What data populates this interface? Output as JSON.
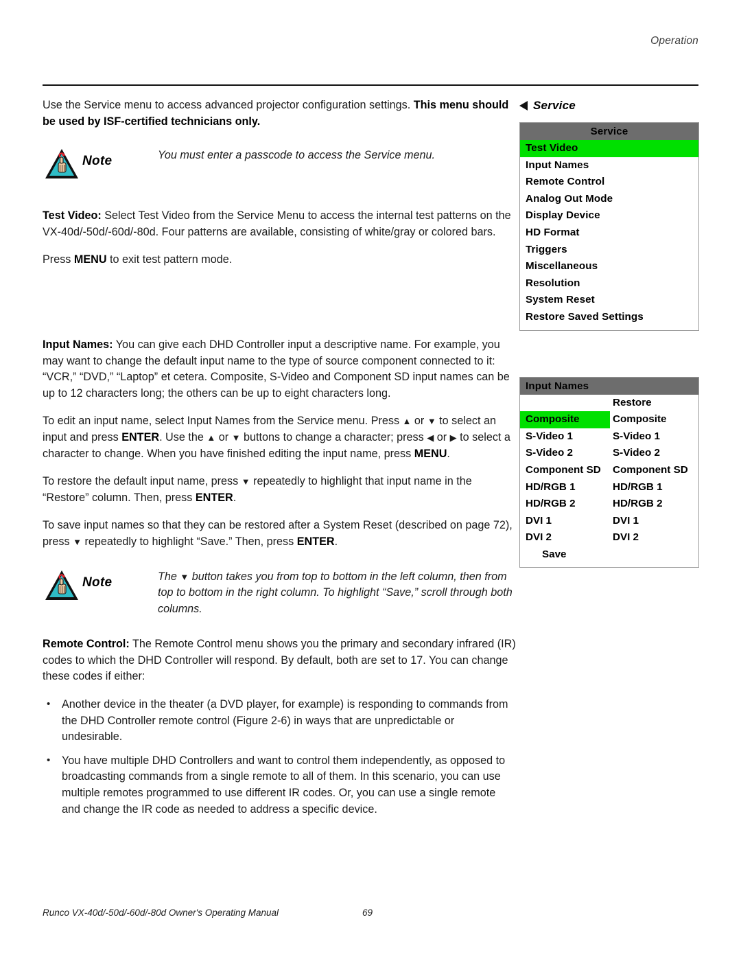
{
  "header": {
    "running_head": "Operation"
  },
  "body": {
    "intro_normal": "Use the Service menu to access advanced projector configuration settings. ",
    "intro_bold": "This menu should be used by ISF-certified technicians only.",
    "note1": "You must enter a passcode to access the Service menu.",
    "note_label": "Note",
    "testvideo_label": "Test Video:",
    "testvideo_text": " Select Test Video from the Service Menu to access the internal test patterns on the VX-40d/-50d/-60d/-80d. Four patterns are available, consisting of white/gray or colored bars.",
    "press_menu_pre": "Press ",
    "press_menu_bold": "MENU",
    "press_menu_post": " to exit test pattern mode.",
    "inputnames_label": "Input Names:",
    "inputnames_text": " You can give each DHD Controller input a descriptive name. For example, you may want to change the default input name to the type of source component connected to it: “VCR,” “DVD,” “Laptop” et cetera. Composite, S-Video and Component SD input names can be up to 12 characters long; the others can be up to eight characters long.",
    "edit_p1": "To edit an input name, select Input Names from the Service menu. Press ",
    "edit_p2": " or ",
    "edit_p3": " to select an input and press ",
    "edit_enter": "ENTER",
    "edit_p4": ". Use the ",
    "edit_p5": " or ",
    "edit_p6": " buttons to change a character; press ",
    "edit_p7": " or ",
    "edit_p8": " to select a character to change. When you have finished editing the input name, press ",
    "edit_menu": "MENU",
    "edit_p9": ".",
    "restore_p1": "To restore the default input name, press ",
    "restore_p2": " repeatedly to highlight that input name in the “Restore” column. Then, press ",
    "restore_enter": "ENTER",
    "restore_p3": ".",
    "save_p1": "To save input names so that they can be restored after a System Reset (described on page 72), press ",
    "save_p2": " repeatedly to highlight “Save.” Then, press ",
    "save_enter": "ENTER",
    "save_p3": ".",
    "note2_p1": "The ",
    "note2_p2": " button takes you from top to bottom in the left column, then from top to bottom in the right column. To highlight “Save,” scroll through both columns.",
    "remote_label": "Remote Control:",
    "remote_text": " The Remote Control menu shows you the primary and secondary infrared (IR) codes to which the DHD Controller will respond. By default, both are set to 17. You can change these codes if either:",
    "bullets": [
      "Another device in the theater (a DVD player, for example) is responding to commands from the DHD Controller remote control (Figure 2-6) in ways that are unpredictable or undesirable.",
      "You have multiple DHD Controllers and want to control them independently, as opposed to broadcasting commands from a single remote to all of them. In this scenario, you can use multiple remotes programmed to use different IR codes. Or, you can use a single remote and change the IR code as needed to address a specific device."
    ],
    "glyphs": {
      "up": "▲",
      "down": "▼",
      "left": "◀",
      "right": "▶"
    }
  },
  "figures": {
    "service": {
      "caption": "Service",
      "title": "Service",
      "selected_index": 0,
      "items": [
        "Test Video",
        "Input Names",
        "Remote Control",
        "Analog Out Mode",
        "Display Device",
        "HD Format",
        "Triggers",
        "Miscellaneous",
        "Resolution",
        "System Reset",
        "Restore Saved Settings"
      ]
    },
    "input_names": {
      "title": "Input Names",
      "restore_header": "Restore",
      "save_label": "Save",
      "selected_row": 0,
      "rows": [
        {
          "left": "Composite",
          "right": "Composite"
        },
        {
          "left": "S-Video 1",
          "right": "S-Video 1"
        },
        {
          "left": "S-Video 2",
          "right": "S-Video 2"
        },
        {
          "left": "Component SD",
          "right": "Component SD"
        },
        {
          "left": "HD/RGB 1",
          "right": "HD/RGB 1"
        },
        {
          "left": "HD/RGB 2",
          "right": "HD/RGB 2"
        },
        {
          "left": "DVI 1",
          "right": "DVI 1"
        },
        {
          "left": "DVI 2",
          "right": "DVI 2"
        }
      ]
    }
  },
  "footer": {
    "text": "Runco VX-40d/-50d/-60d/-80d Owner's Operating Manual",
    "page": "69"
  },
  "colors": {
    "highlight_green": "#00e000",
    "osd_header_gray": "#6d6d6d",
    "note_icon_fill": "#2fbdc7"
  }
}
